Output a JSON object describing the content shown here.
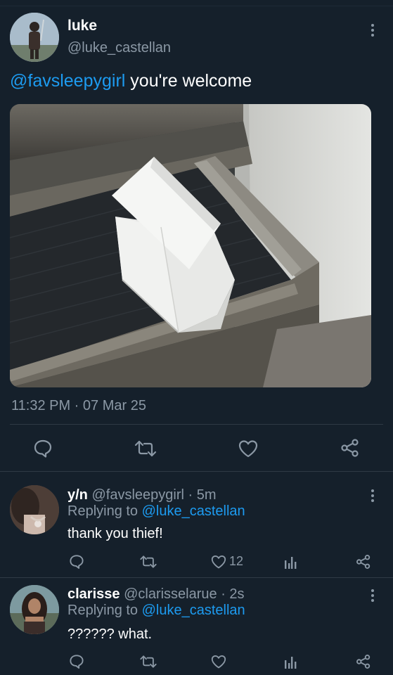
{
  "tweet": {
    "display_name": "luke",
    "handle": "@luke_castellan",
    "mention": "@favsleepygirl",
    "text": " you're welcome",
    "timestamp": "11:32 PM · 07 Mar 25",
    "icons": [
      "reply-icon",
      "retweet-icon",
      "like-icon",
      "share-icon",
      "more-icon"
    ]
  },
  "replies": [
    {
      "display_name": "y/n",
      "handle_time": "@favsleepygirl · 5m",
      "replying_prefix": "Replying to ",
      "replying_to": "@luke_castellan",
      "text": "thank you thief!",
      "like_count": "12"
    },
    {
      "display_name": "clarisse",
      "handle_time": "@clarisselarue · 2s",
      "replying_prefix": "Replying to ",
      "replying_to": "@luke_castellan",
      "text": "?????? what.",
      "like_count": ""
    }
  ],
  "colors": {
    "background": "#15202b",
    "accent": "#1d9bf0",
    "muted": "#8b98a5",
    "divider": "#2f3a45"
  }
}
